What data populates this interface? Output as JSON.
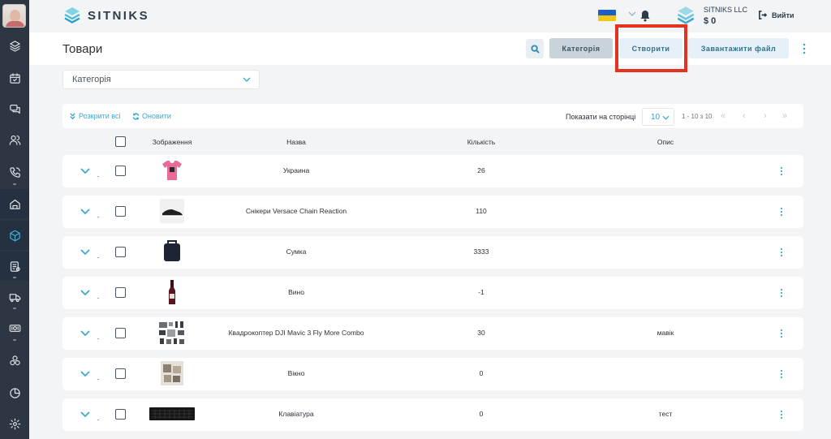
{
  "brand": {
    "name": "SITNIKS"
  },
  "header": {
    "company_name": "SITNIKS LLC",
    "balance": "$ 0",
    "logout_label": "Вийти"
  },
  "page": {
    "title": "Товари",
    "buttons": {
      "category": "Категорія",
      "create": "Створити",
      "upload": "Завантажити файл"
    }
  },
  "filter": {
    "category_label": "Категорія"
  },
  "toolbar": {
    "expand_all": "Розкрити всі",
    "refresh": "Оновити",
    "per_page_label": "Показати на сторінці",
    "per_page_value": "10",
    "range": "1 - 10 з 10"
  },
  "table": {
    "columns": {
      "image": "Зображення",
      "name": "Назва",
      "quantity": "Кількість",
      "description": "Опис"
    },
    "rows": [
      {
        "name": "Украина",
        "quantity": "26",
        "description": "",
        "image": "pink-tshirt"
      },
      {
        "name": "Снікери Versace Chain Reaction",
        "quantity": "110",
        "description": "",
        "image": "sneaker"
      },
      {
        "name": "Сумка",
        "quantity": "3333",
        "description": "",
        "image": "bag"
      },
      {
        "name": "Вино",
        "quantity": "-1",
        "description": "",
        "image": "wine-bottle"
      },
      {
        "name": "Квадрокоптер DJI Mavic 3 Fly More Combo",
        "quantity": "30",
        "description": "мавік",
        "image": "drone-kit"
      },
      {
        "name": "Вікно",
        "quantity": "0",
        "description": "",
        "image": "window"
      },
      {
        "name": "Клавіатура",
        "quantity": "0",
        "description": "тест",
        "image": "keyboard"
      }
    ]
  },
  "sidebar": {
    "items": [
      "layers-icon",
      "calendar-icon",
      "chat-icon",
      "users-icon",
      "phone-icon",
      "home-icon",
      "products-icon",
      "orders-icon",
      "delivery-icon",
      "finance-icon",
      "integrations-icon",
      "analytics-icon",
      "settings-icon"
    ]
  },
  "colors": {
    "accent": "#3fb6d8",
    "sidebar": "#2d3643",
    "highlight": "#e5321e",
    "category_button": "#c8d3da"
  }
}
